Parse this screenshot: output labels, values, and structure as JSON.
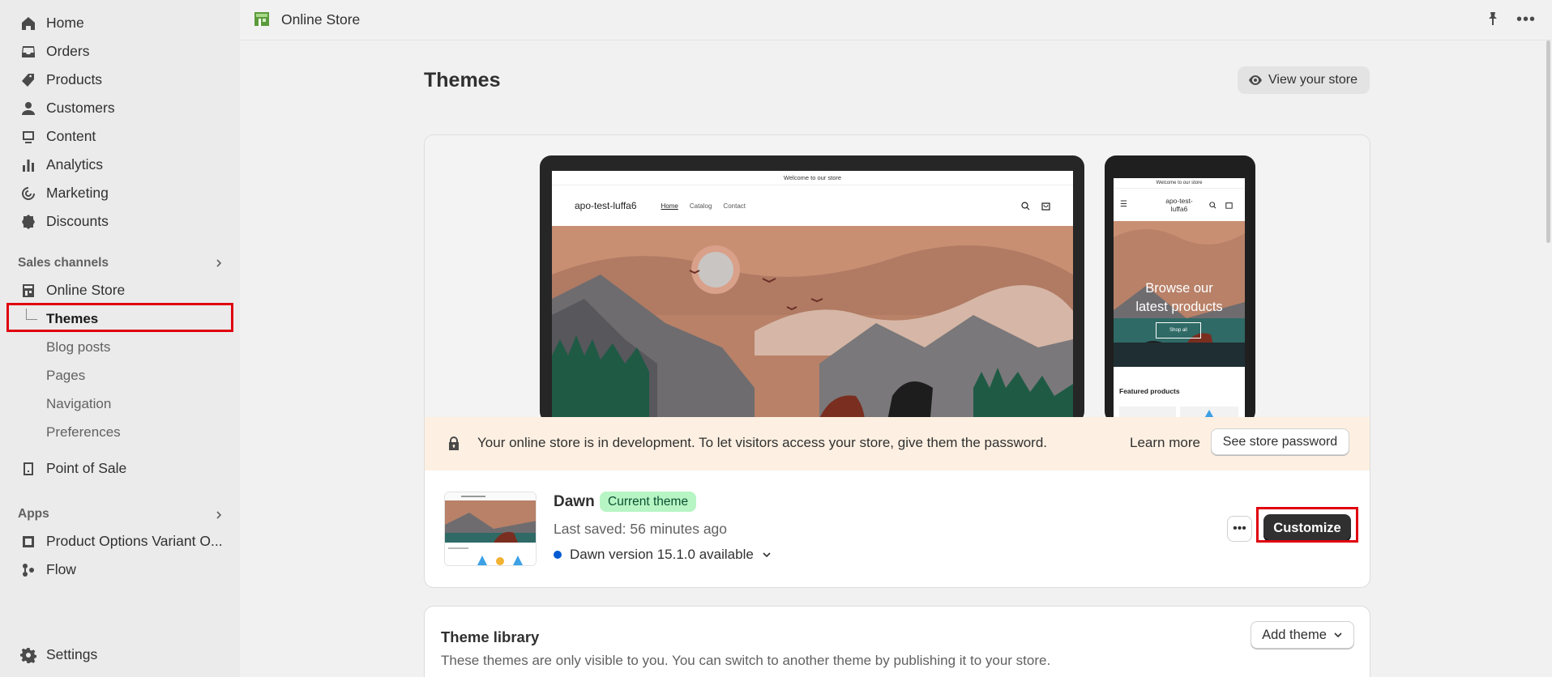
{
  "sidebar": {
    "main_items": [
      {
        "label": "Home",
        "icon": "home-icon"
      },
      {
        "label": "Orders",
        "icon": "inbox-icon"
      },
      {
        "label": "Products",
        "icon": "tag-icon"
      },
      {
        "label": "Customers",
        "icon": "person-icon"
      },
      {
        "label": "Content",
        "icon": "content-icon"
      },
      {
        "label": "Analytics",
        "icon": "bar-chart-icon"
      },
      {
        "label": "Marketing",
        "icon": "target-icon"
      },
      {
        "label": "Discounts",
        "icon": "discount-icon"
      }
    ],
    "sales_channels_label": "Sales channels",
    "online_store_label": "Online Store",
    "sub_items": [
      "Themes",
      "Blog posts",
      "Pages",
      "Navigation",
      "Preferences"
    ],
    "point_of_sale_label": "Point of Sale",
    "apps_label": "Apps",
    "apps": [
      "Product Options Variant O...",
      "Flow"
    ],
    "settings_label": "Settings"
  },
  "topbar": {
    "title": "Online Store"
  },
  "main": {
    "page_title": "Themes",
    "view_store_label": "View your store",
    "preview": {
      "announcement": "Welcome to our store",
      "store_name": "apo-test-luffa6",
      "nav_links": [
        "Home",
        "Catalog",
        "Contact"
      ],
      "phone_store_name": "apo-test-luffa6",
      "phone_hero_line1": "Browse our",
      "phone_hero_line2": "latest products",
      "phone_shop_all": "Shop all",
      "phone_featured": "Featured products"
    },
    "banner": {
      "text": "Your online store is in development. To let visitors access your store, give them the password.",
      "learn_more": "Learn more",
      "password_button": "See store password"
    },
    "current_theme": {
      "name": "Dawn",
      "badge": "Current theme",
      "last_saved": "Last saved: 56 minutes ago",
      "version_notice": "Dawn version 15.1.0 available",
      "customize_label": "Customize"
    },
    "library": {
      "title": "Theme library",
      "description": "These themes are only visible to you. You can switch to another theme by publishing it to your store.",
      "add_theme_label": "Add theme"
    }
  },
  "colors": {
    "highlight": "#e0000f",
    "badge_bg": "#b7f5c4",
    "primary_button": "#303030",
    "banner_bg": "#fdf0e2"
  }
}
